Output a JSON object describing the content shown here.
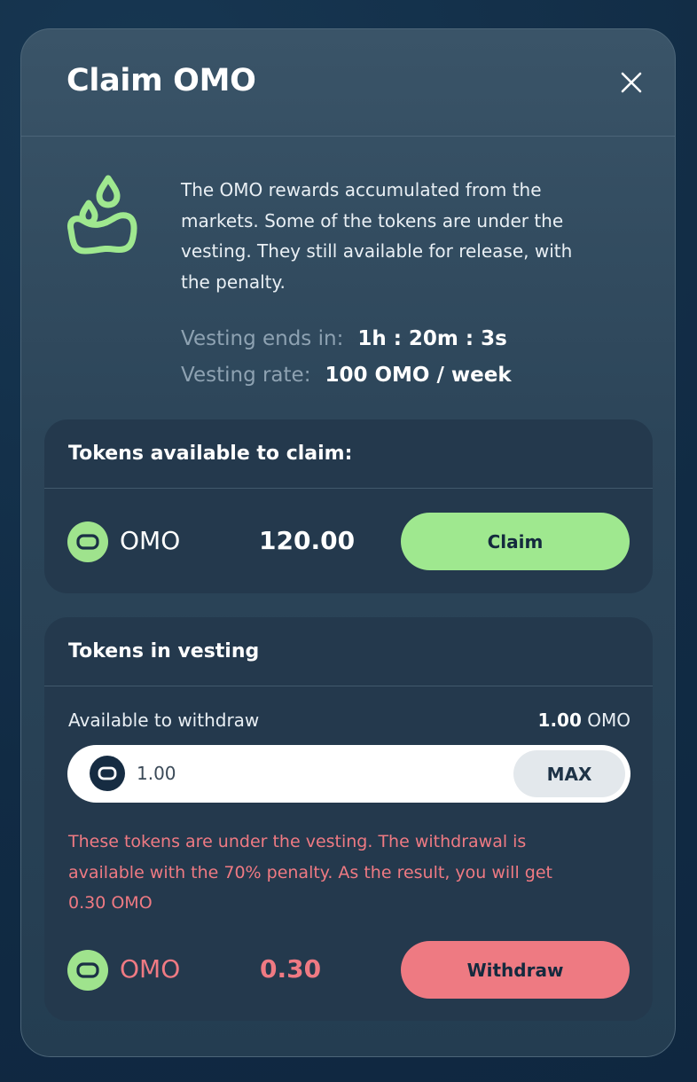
{
  "modal": {
    "title": "Claim OMO",
    "close_icon": "close-icon",
    "intro_icon": "omo-drops-icon",
    "description": "The OMO rewards accumulated from the markets. Some of the tokens are under the vesting. They still available for release, with the penalty.",
    "vesting_ends_label": "Vesting ends in:",
    "vesting_ends_value": "1h : 20m : 3s",
    "vesting_rate_label": "Vesting rate:",
    "vesting_rate_value": "100 OMO / week"
  },
  "claim_card": {
    "title": "Tokens available to claim:",
    "token_icon": "omo-token-icon",
    "token_symbol": "OMO",
    "amount": "120.00",
    "claim_label": "Claim"
  },
  "vesting_card": {
    "title": "Tokens in vesting",
    "available_label": "Available to withdraw",
    "available_amount": "1.00",
    "available_unit": "OMO",
    "input_value": "1.00",
    "max_label": "MAX",
    "warning": "These tokens are under the vesting. The withdrawal is available with the 70% penalty. As the result, you will get 0.30 OMO",
    "token_symbol": "OMO",
    "receive_amount": "0.30",
    "withdraw_label": "Withdraw"
  },
  "colors": {
    "accent_green": "#9fe88f",
    "accent_red": "#ee7a82",
    "modal_bg": "#2c4559",
    "card_bg": "#24394d"
  }
}
